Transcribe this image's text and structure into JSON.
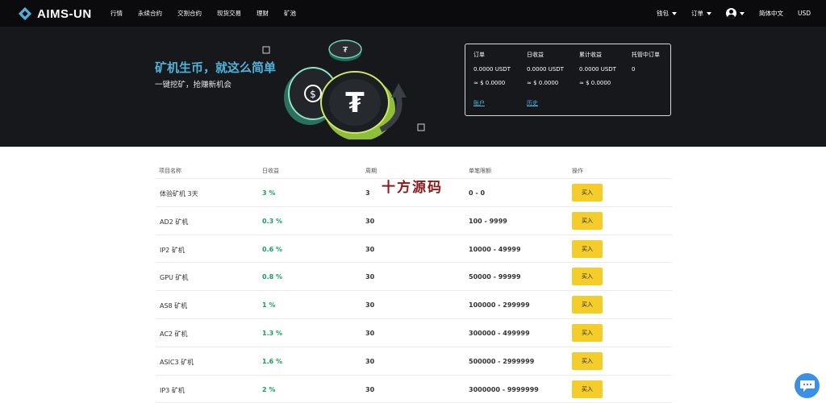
{
  "colors": {
    "accent": "#4fb3d9",
    "nav_bg": "#0b0b0d",
    "hero_bg": "#17181c",
    "green": "#16a05d",
    "buy_button": "#f5cd2a",
    "chat": "#3a8fe6"
  },
  "brand": {
    "name": "AIMS-UN"
  },
  "nav": {
    "links": [
      "行情",
      "永续合约",
      "交割合约",
      "现货交易",
      "理财",
      "矿池"
    ],
    "wallet": "钱包",
    "orders": "订单",
    "language": "简体中文",
    "currency": "USD"
  },
  "hero": {
    "title": "矿机生币，就这么简单",
    "subtitle": "一键挖矿，抢赚新机会"
  },
  "stats": {
    "orders": {
      "label": "订单",
      "value": "0.0000 USDT",
      "approx": "≈ $ 0.0000"
    },
    "daily": {
      "label": "日收益",
      "value": "0.0000 USDT",
      "approx": "≈ $ 0.0000"
    },
    "total": {
      "label": "累计收益",
      "value": "0.0000 USDT",
      "approx": "≈ $ 0.0000"
    },
    "hosted": {
      "label": "托管中订单",
      "value": "0"
    },
    "account_link": "账户",
    "history_link": "历史"
  },
  "table": {
    "headers": [
      "项目名称",
      "日收益",
      "周期",
      "单笔限额",
      "操作"
    ],
    "buy_label": "买入",
    "rows": [
      {
        "name": "体验矿机 3天",
        "rate": "3 %",
        "period": "3",
        "limit": "0 - 0"
      },
      {
        "name": "AD2 矿机",
        "rate": "0.3 %",
        "period": "30",
        "limit": "100 - 9999"
      },
      {
        "name": "IP2 矿机",
        "rate": "0.6 %",
        "period": "30",
        "limit": "10000 - 49999"
      },
      {
        "name": "GPU 矿机",
        "rate": "0.8 %",
        "period": "30",
        "limit": "50000 - 99999"
      },
      {
        "name": "AS8 矿机",
        "rate": "1 %",
        "period": "30",
        "limit": "100000 - 299999"
      },
      {
        "name": "AC2 矿机",
        "rate": "1.3 %",
        "period": "30",
        "limit": "300000 - 499999"
      },
      {
        "name": "ASIC3 矿机",
        "rate": "1.6 %",
        "period": "30",
        "limit": "500000 - 2999999"
      },
      {
        "name": "IP3 矿机",
        "rate": "2 %",
        "period": "30",
        "limit": "3000000 - 9999999"
      }
    ]
  },
  "watermark": "十方源码",
  "icons": {
    "logo": "diamond-logo-icon",
    "user": "user-icon",
    "chat": "chat-bubble-icon"
  }
}
